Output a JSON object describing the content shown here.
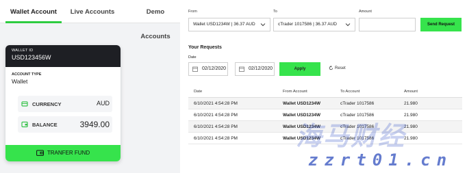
{
  "tabs": [
    {
      "label": "Wallet Account",
      "active": true
    },
    {
      "label": "Live Accounts",
      "active": false
    },
    {
      "label": "Demo Accounts",
      "active": false
    }
  ],
  "card": {
    "wallet_id_label": "WALLET ID",
    "wallet_id": "USD123456W",
    "account_type_label": "ACCOUNT TYPE",
    "account_type": "Wallet",
    "currency_label": "CURRENCY",
    "currency": "AUD",
    "balance_label": "BALANCE",
    "balance": "3949.00",
    "transfer_label": "TRANFER FUND"
  },
  "transfer_form": {
    "from_label": "From",
    "from_value": "Wallet USD1234W | 36.37 AUD",
    "to_label": "To",
    "to_value": "cTrader 1017586 | 36.37 AUD",
    "amount_label": "Amount",
    "amount_value": "",
    "send_label": "Send Request"
  },
  "requests": {
    "title": "Your Requests",
    "date_label": "Date",
    "date_from": "02/12/2020",
    "date_to": "02/12/2020",
    "apply_label": "Apply",
    "reset_label": "Reset",
    "columns": [
      "Date",
      "From Account",
      "To Account",
      "Amount"
    ],
    "rows": [
      {
        "date": "6/10/2021 4:54:28 PM",
        "from": "Wallet USD1234W",
        "to": "cTrader 1017586",
        "amount": "21.980"
      },
      {
        "date": "6/10/2021 4:54:28 PM",
        "from": "Wallet USD1234W",
        "to": "cTrader 1017586",
        "amount": "21.980"
      },
      {
        "date": "6/10/2021 4:54:28 PM",
        "from": "Wallet USD1234W",
        "to": "cTrader 1017586",
        "amount": "21.980"
      },
      {
        "date": "6/10/2021 4:54:28 PM",
        "from": "Wallet USD1234W",
        "to": "cTrader 1017586",
        "amount": "21.980"
      }
    ]
  },
  "watermark": {
    "text": "海马财经",
    "url": "zzrt01.cn"
  },
  "colors": {
    "accent": "#36e34c",
    "dark": "#1e1f24"
  }
}
